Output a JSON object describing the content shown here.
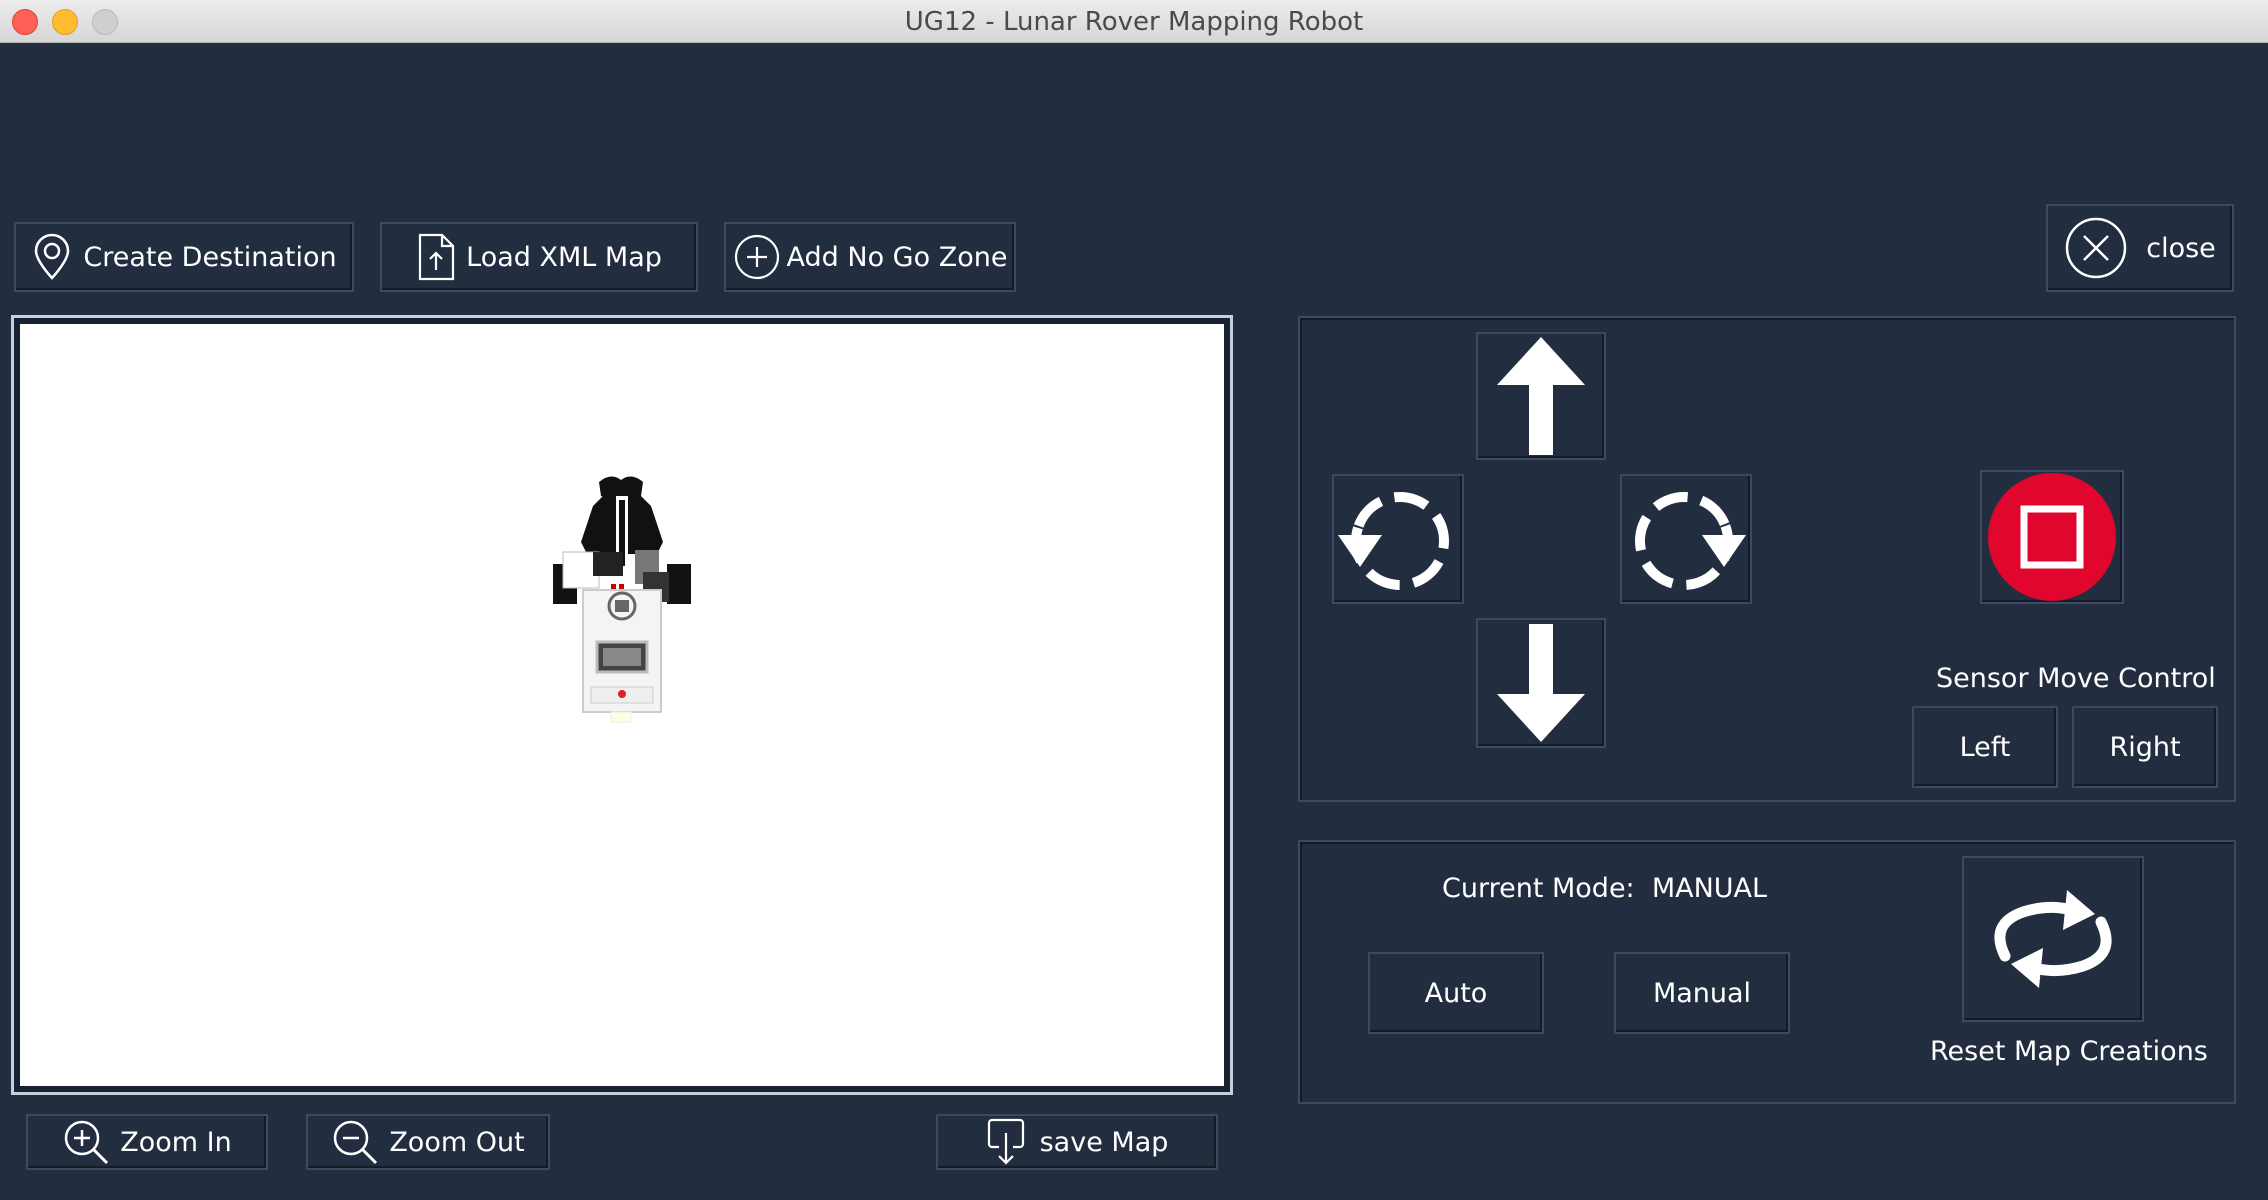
{
  "window": {
    "title": "UG12 - Lunar Rover Mapping Robot"
  },
  "toolbar": {
    "create_destination": "Create Destination",
    "load_xml_map": "Load XML Map",
    "add_no_go_zone": "Add No Go Zone",
    "close": "close"
  },
  "map_controls": {
    "zoom_in": "Zoom In",
    "zoom_out": "Zoom Out",
    "save_map": "save Map"
  },
  "movement": {
    "forward_icon": "arrow-up-icon",
    "backward_icon": "arrow-down-icon",
    "rotate_left_icon": "rotate-left-icon",
    "rotate_right_icon": "rotate-right-icon",
    "stop_icon": "stop-icon",
    "stop_color": "#e0062e"
  },
  "sensor": {
    "title": "Sensor Move Control",
    "left": "Left",
    "right": "Right"
  },
  "mode": {
    "label": "Current Mode:",
    "value": "MANUAL",
    "auto": "Auto",
    "manual": "Manual"
  },
  "reset": {
    "label": "Reset Map Creations"
  },
  "colors": {
    "background": "#222d40",
    "border": "#3b4a62",
    "map_background": "#ffffff"
  }
}
